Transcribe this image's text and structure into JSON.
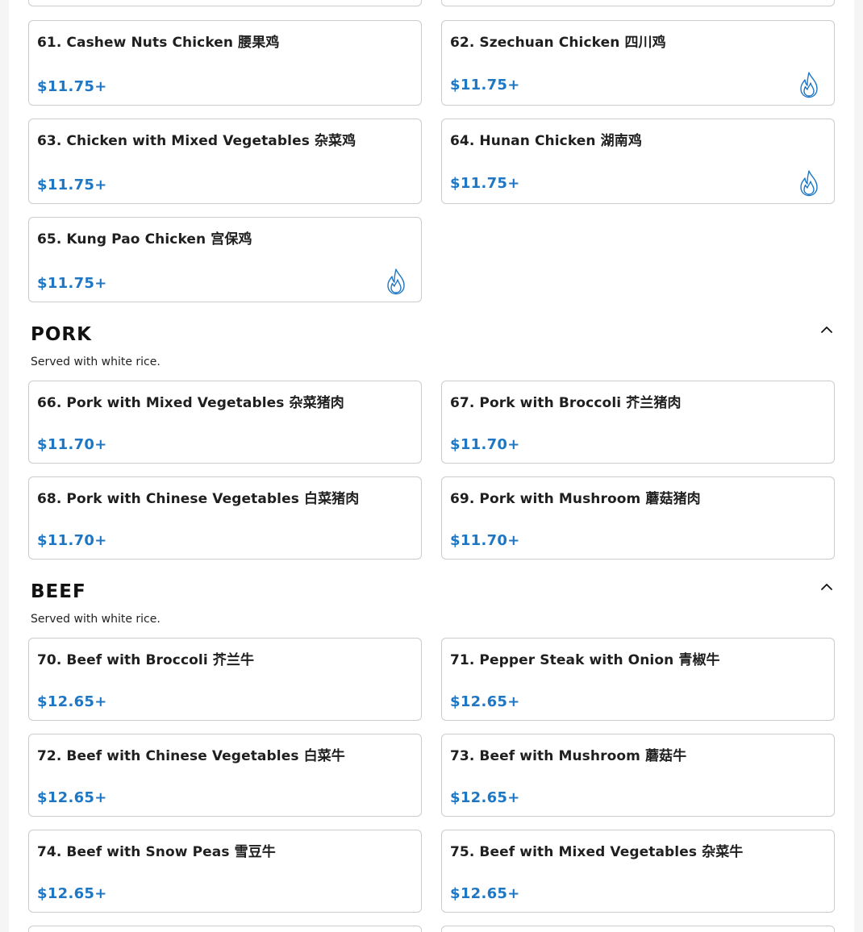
{
  "chicken": {
    "items": [
      {
        "name": "61. Cashew Nuts Chicken 腰果鸡",
        "price": "$11.75+"
      },
      {
        "name": "62. Szechuan Chicken 四川鸡",
        "price": "$11.75+"
      },
      {
        "name": "63. Chicken with Mixed Vegetables 杂菜鸡",
        "price": "$11.75+"
      },
      {
        "name": "64. Hunan Chicken 湖南鸡",
        "price": "$11.75+"
      },
      {
        "name": "65. Kung Pao Chicken 宫保鸡",
        "price": "$11.75+"
      }
    ]
  },
  "pork": {
    "title": "PORK",
    "description": "Served with white rice.",
    "items": [
      {
        "name": "66. Pork with Mixed Vegetables 杂菜猪肉",
        "price": "$11.70+"
      },
      {
        "name": "67. Pork with Broccoli 芥兰猪肉",
        "price": "$11.70+"
      },
      {
        "name": "68. Pork with Chinese Vegetables 白菜猪肉",
        "price": "$11.70+"
      },
      {
        "name": "69. Pork with Mushroom 蘑菇猪肉",
        "price": "$11.70+"
      }
    ]
  },
  "beef": {
    "title": "BEEF",
    "description": "Served with white rice.",
    "items": [
      {
        "name": "70. Beef with Broccoli 芥兰牛",
        "price": "$12.65+"
      },
      {
        "name": "71. Pepper Steak with Onion 青椒牛",
        "price": "$12.65+"
      },
      {
        "name": "72. Beef with Chinese Vegetables 白菜牛",
        "price": "$12.65+"
      },
      {
        "name": "73. Beef with Mushroom 蘑菇牛",
        "price": "$12.65+"
      },
      {
        "name": "74. Beef with Snow Peas 雪豆牛",
        "price": "$12.65+"
      },
      {
        "name": "75. Beef with Mixed Vegetables 杂菜牛",
        "price": "$12.65+"
      }
    ]
  },
  "icons": {
    "spicy": "flame-icon",
    "collapse": "chevron-up-icon"
  },
  "colors": {
    "price": "#1f77c4",
    "card_border": "#cccccc",
    "page_bg": "#ffffff"
  }
}
